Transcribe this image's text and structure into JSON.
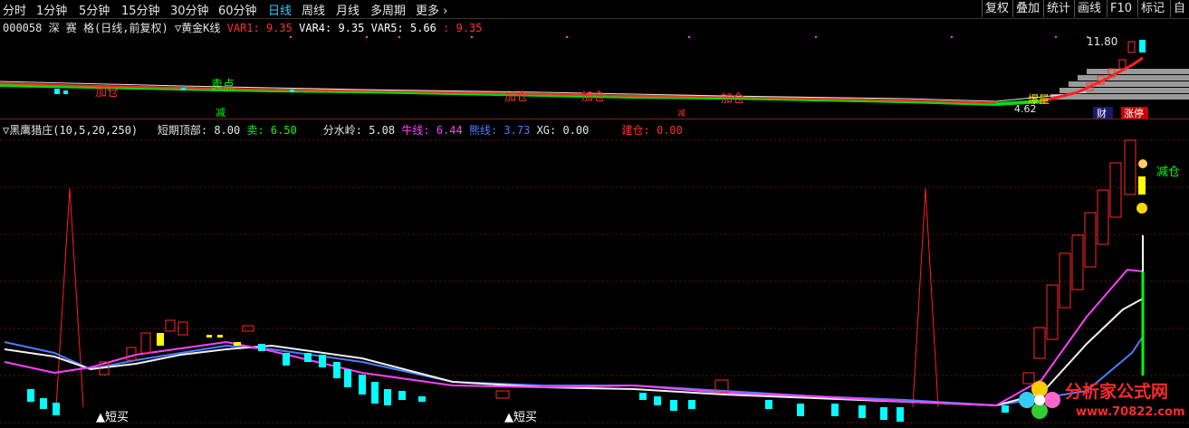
{
  "toolbar": {
    "periods": [
      "分时",
      "1分钟",
      "5分钟",
      "15分钟",
      "30分钟",
      "60分钟",
      "日线",
      "周线",
      "月线",
      "多周期",
      "更多 ›"
    ],
    "active_period": "日线",
    "buttons": [
      "复权",
      "叠加",
      "统计",
      "画线",
      "F10",
      "标记",
      "自"
    ]
  },
  "upper_panel": {
    "stock": "000058 深 赛 格(日线,前复权)",
    "indicator": "▽黄金K线",
    "var1_label": "VAR1:",
    "var1_value": "9.35",
    "var4_label": "VAR4:",
    "var4_value": "9.35",
    "var5_label": "VAR5:",
    "var5_value": "5.66",
    "extra_label": ":",
    "extra_value": "9.35",
    "max_price": "11.80",
    "min_price": "4.62",
    "signals": [
      "加仓",
      "卖点",
      "加仓",
      "加仓",
      "加仓",
      "减",
      "减",
      "爆量",
      "财",
      "涨停"
    ]
  },
  "lower_panel": {
    "indicator": "▽黑鹰猎庄(10,5,20,250)",
    "short_top_label": "短期顶部:",
    "short_top_value": "8.00",
    "sell_label": "卖:",
    "sell_value": "6.50",
    "water_label": "分水岭:",
    "water_value": "5.08",
    "bull_label": "牛线:",
    "bull_value": "6.44",
    "bear_label": "熊线:",
    "bear_value": "3.73",
    "xg_label": "XG:",
    "xg_value": "0.00",
    "build_label": "建仓:",
    "build_value": "0.00",
    "signals": [
      "▲短买",
      "▲短买",
      "减仓"
    ]
  },
  "watermark": {
    "brand": "分析家公式网",
    "url": "www.70822.com"
  },
  "colors": {
    "bg": "#000000",
    "up": "#ff3030",
    "down": "#00ffff",
    "green": "#00ff00",
    "pink": "#ff40ff",
    "blue": "#4f7cff",
    "yellow": "#ffff00",
    "grid": "#7a1010"
  }
}
